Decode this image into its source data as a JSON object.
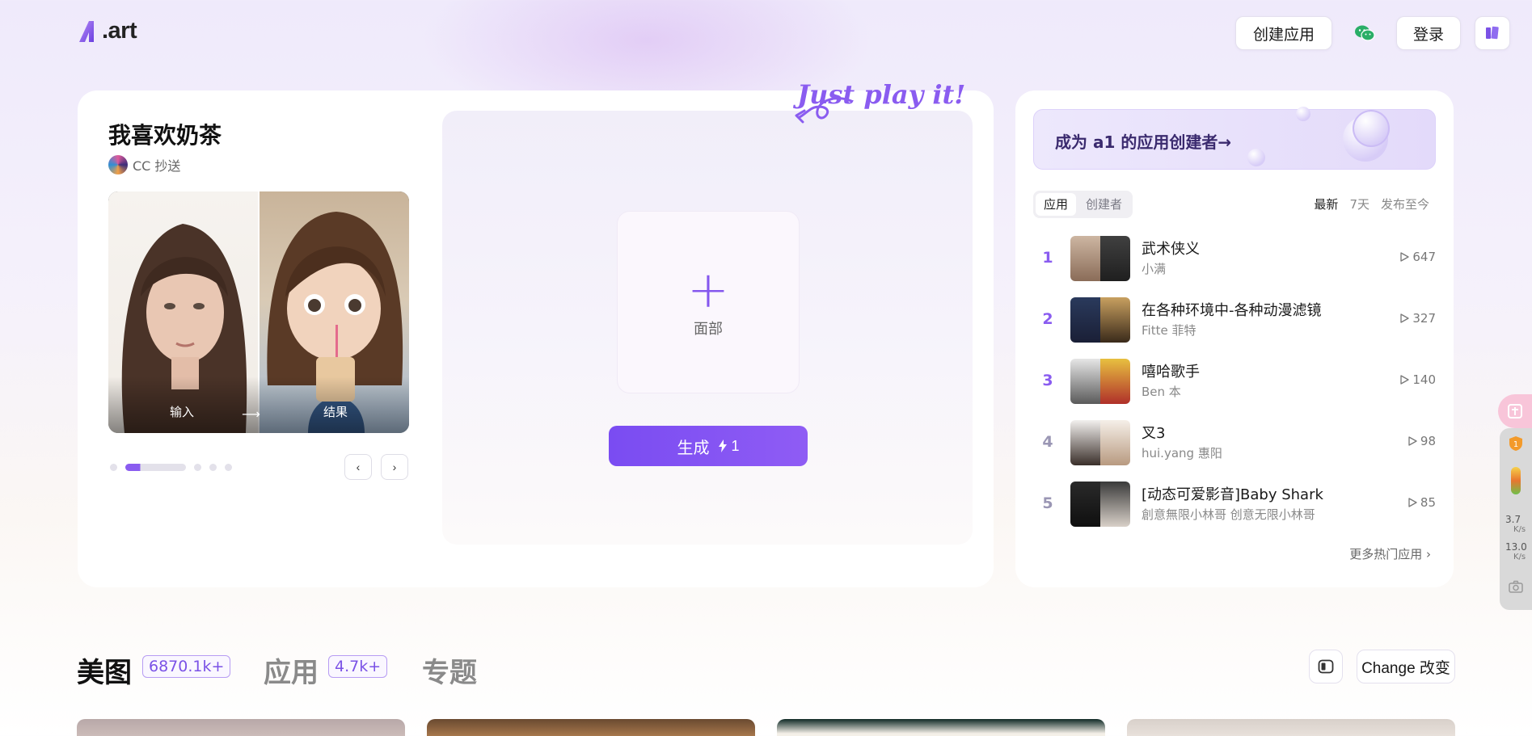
{
  "header": {
    "logo_text": ".art",
    "create_app_label": "创建应用",
    "login_label": "登录"
  },
  "app": {
    "title": "我喜欢奶茶",
    "author": "CC 抄送",
    "preview_input_label": "输入",
    "preview_arrow": "⟶",
    "preview_output_label": "结果",
    "carousel": {
      "active_index": 1,
      "count": 5
    },
    "prev_icon": "‹",
    "next_icon": "›"
  },
  "upload": {
    "plus_icon": "+",
    "label": "面部",
    "generate_label": "生成",
    "cost": "1",
    "tagline": "Just play it!"
  },
  "sidebar": {
    "banner_text": "成为 a1 的应用创建者→",
    "tabs": [
      {
        "label": "应用",
        "active": true
      },
      {
        "label": "创建者",
        "active": false
      }
    ],
    "ranges": [
      {
        "label": "最新",
        "active": true
      },
      {
        "label": "7天",
        "active": false
      },
      {
        "label": "发布至今",
        "active": false
      }
    ],
    "ranking": [
      {
        "rank": "1",
        "title": "武术侠义",
        "author": "小满",
        "plays": "647"
      },
      {
        "rank": "2",
        "title": "在各种环境中-各种动漫滤镜",
        "author": "Fitte 菲特",
        "plays": "327"
      },
      {
        "rank": "3",
        "title": "嘻哈歌手",
        "author": "Ben 本",
        "plays": "140"
      },
      {
        "rank": "4",
        "title": "叉3",
        "author": "hui.yang 惠阳",
        "plays": "98"
      },
      {
        "rank": "5",
        "title": "[动态可爱影音]Baby Shark",
        "author": "創意無限小林哥 创意无限小林哥",
        "plays": "85"
      }
    ],
    "more_label": "更多热门应用 ›"
  },
  "widget": {
    "up_speed": "3.7",
    "down_speed": "13.0",
    "unit": "K/s"
  },
  "feed": {
    "tabs": [
      {
        "label": "美图",
        "count": "6870.1k+",
        "active": true
      },
      {
        "label": "应用",
        "count": "4.7k+",
        "active": false
      },
      {
        "label": "专题",
        "count": "",
        "active": false
      }
    ],
    "change_label": "Change 改变"
  },
  "colors": {
    "accent": "#8a5cf0",
    "accent_dark": "#7a4cf2",
    "rank_dim": "#9a96b4",
    "wechat": "#2aae67"
  },
  "icons": {
    "wechat": "wechat-icon",
    "book": "book-icon",
    "play": "play-icon",
    "lightning": "lightning-icon",
    "layout": "layout-toggle-icon"
  }
}
